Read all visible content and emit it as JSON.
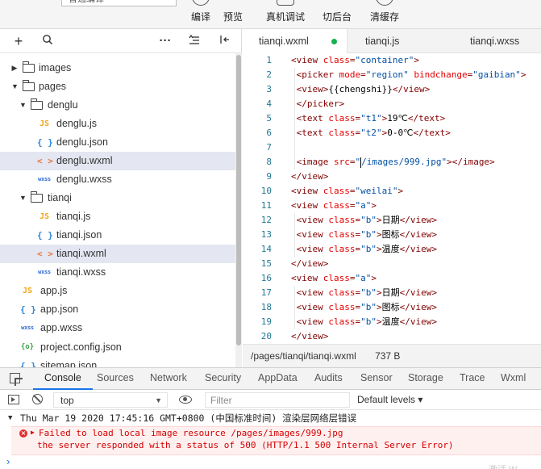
{
  "toolbar": {
    "compile_mode": "普通编译",
    "buttons": [
      {
        "label": "编译",
        "icon": "refresh-icon"
      },
      {
        "label": "预览",
        "icon": "eye-icon"
      },
      {
        "label": "真机调试",
        "icon": "debug-icon"
      },
      {
        "label": "切后台",
        "icon": "background-icon"
      },
      {
        "label": "清缓存",
        "icon": "clear-cache-icon"
      }
    ]
  },
  "explorer": {
    "tools": {
      "add": "+",
      "search": "search-icon",
      "more": "···",
      "sort": "sort-icon",
      "collapse": "collapse-icon"
    },
    "tree": [
      {
        "label": "images",
        "type": "folder",
        "expanded": false
      },
      {
        "label": "pages",
        "type": "folder",
        "expanded": true
      },
      {
        "label": "denglu",
        "type": "folder",
        "expanded": true
      },
      {
        "label": "denglu.js",
        "type": "js",
        "badge": "JS"
      },
      {
        "label": "denglu.json",
        "type": "json",
        "badge": "{ }"
      },
      {
        "label": "denglu.wxml",
        "type": "wxml",
        "badge": "< >"
      },
      {
        "label": "denglu.wxss",
        "type": "wxss",
        "badge": "wxss"
      },
      {
        "label": "tianqi",
        "type": "folder",
        "expanded": true
      },
      {
        "label": "tianqi.js",
        "type": "js",
        "badge": "JS"
      },
      {
        "label": "tianqi.json",
        "type": "json",
        "badge": "{ }"
      },
      {
        "label": "tianqi.wxml",
        "type": "wxml",
        "badge": "< >"
      },
      {
        "label": "tianqi.wxss",
        "type": "wxss",
        "badge": "wxss"
      },
      {
        "label": "app.js",
        "type": "js",
        "badge": "JS"
      },
      {
        "label": "app.json",
        "type": "json",
        "badge": "{ }"
      },
      {
        "label": "app.wxss",
        "type": "wxss",
        "badge": "wxss"
      },
      {
        "label": "project.config.json",
        "type": "cfg",
        "badge": "{o}"
      },
      {
        "label": "sitemap.json",
        "type": "json",
        "badge": "{ }"
      }
    ]
  },
  "editor": {
    "tabs": [
      {
        "label": "tianqi.wxml",
        "active": true,
        "modified": true
      },
      {
        "label": "tianqi.js",
        "active": false
      },
      {
        "label": "tianqi.wxss",
        "active": false
      }
    ],
    "lines": [
      {
        "n": "1",
        "segs": [
          [
            "tag",
            "<view "
          ],
          [
            "attr",
            "class"
          ],
          [
            "tag",
            "="
          ],
          [
            "val",
            "\"container\""
          ],
          [
            "tag",
            ">"
          ]
        ]
      },
      {
        "n": "2",
        "segs": [
          [
            "tag",
            " <picker "
          ],
          [
            "attr",
            "mode"
          ],
          [
            "tag",
            "="
          ],
          [
            "val",
            "\"region\""
          ],
          [
            "tag",
            " "
          ],
          [
            "attr",
            "bindchange"
          ],
          [
            "tag",
            "="
          ],
          [
            "val",
            "\"gaibian\""
          ],
          [
            "tag",
            ">"
          ]
        ]
      },
      {
        "n": "3",
        "segs": [
          [
            "tag",
            " <view>"
          ],
          [
            "txt",
            "{{chengshi}}"
          ],
          [
            "tag",
            "</view>"
          ]
        ]
      },
      {
        "n": "4",
        "segs": [
          [
            "tag",
            " </picker>"
          ]
        ]
      },
      {
        "n": "5",
        "segs": [
          [
            "tag",
            " <text "
          ],
          [
            "attr",
            "class"
          ],
          [
            "tag",
            "="
          ],
          [
            "val",
            "\"t1\""
          ],
          [
            "tag",
            ">"
          ],
          [
            "txt",
            "19℃"
          ],
          [
            "tag",
            "</text>"
          ]
        ]
      },
      {
        "n": "6",
        "segs": [
          [
            "tag",
            " <text "
          ],
          [
            "attr",
            "class"
          ],
          [
            "tag",
            "="
          ],
          [
            "val",
            "\"t2\""
          ],
          [
            "tag",
            ">"
          ],
          [
            "txt",
            "0-0℃"
          ],
          [
            "tag",
            "</text>"
          ]
        ]
      },
      {
        "n": "7",
        "segs": []
      },
      {
        "n": "8",
        "segs": [
          [
            "tag",
            " <image "
          ],
          [
            "attr",
            "src"
          ],
          [
            "tag",
            "="
          ],
          [
            "val",
            "\""
          ],
          [
            "cursor",
            ""
          ],
          [
            "val",
            "/images/999.jpg\""
          ],
          [
            "tag",
            "></image>"
          ]
        ]
      },
      {
        "n": "9",
        "segs": [
          [
            "tag",
            "</view>"
          ]
        ]
      },
      {
        "n": "10",
        "segs": [
          [
            "tag",
            "<view "
          ],
          [
            "attr",
            "class"
          ],
          [
            "tag",
            "="
          ],
          [
            "val",
            "\"weilai\""
          ],
          [
            "tag",
            ">"
          ]
        ]
      },
      {
        "n": "11",
        "segs": [
          [
            "tag",
            "<view "
          ],
          [
            "attr",
            "class"
          ],
          [
            "tag",
            "="
          ],
          [
            "val",
            "\"a\""
          ],
          [
            "tag",
            ">"
          ]
        ]
      },
      {
        "n": "12",
        "segs": [
          [
            "tag",
            " <view "
          ],
          [
            "attr",
            "class"
          ],
          [
            "tag",
            "="
          ],
          [
            "val",
            "\"b\""
          ],
          [
            "tag",
            ">"
          ],
          [
            "txt",
            "日期"
          ],
          [
            "tag",
            "</view>"
          ]
        ]
      },
      {
        "n": "13",
        "segs": [
          [
            "tag",
            " <view "
          ],
          [
            "attr",
            "class"
          ],
          [
            "tag",
            "="
          ],
          [
            "val",
            "\"b\""
          ],
          [
            "tag",
            ">"
          ],
          [
            "txt",
            "图标"
          ],
          [
            "tag",
            "</view>"
          ]
        ]
      },
      {
        "n": "14",
        "segs": [
          [
            "tag",
            " <view "
          ],
          [
            "attr",
            "class"
          ],
          [
            "tag",
            "="
          ],
          [
            "val",
            "\"b\""
          ],
          [
            "tag",
            ">"
          ],
          [
            "txt",
            "温度"
          ],
          [
            "tag",
            "</view>"
          ]
        ]
      },
      {
        "n": "15",
        "segs": [
          [
            "tag",
            "</view>"
          ]
        ]
      },
      {
        "n": "16",
        "segs": [
          [
            "tag",
            "<view "
          ],
          [
            "attr",
            "class"
          ],
          [
            "tag",
            "="
          ],
          [
            "val",
            "\"a\""
          ],
          [
            "tag",
            ">"
          ]
        ]
      },
      {
        "n": "17",
        "segs": [
          [
            "tag",
            " <view "
          ],
          [
            "attr",
            "class"
          ],
          [
            "tag",
            "="
          ],
          [
            "val",
            "\"b\""
          ],
          [
            "tag",
            ">"
          ],
          [
            "txt",
            "日期"
          ],
          [
            "tag",
            "</view>"
          ]
        ]
      },
      {
        "n": "18",
        "segs": [
          [
            "tag",
            " <view "
          ],
          [
            "attr",
            "class"
          ],
          [
            "tag",
            "="
          ],
          [
            "val",
            "\"b\""
          ],
          [
            "tag",
            ">"
          ],
          [
            "txt",
            "图标"
          ],
          [
            "tag",
            "</view>"
          ]
        ]
      },
      {
        "n": "19",
        "segs": [
          [
            "tag",
            " <view "
          ],
          [
            "attr",
            "class"
          ],
          [
            "tag",
            "="
          ],
          [
            "val",
            "\"b\""
          ],
          [
            "tag",
            ">"
          ],
          [
            "txt",
            "温度"
          ],
          [
            "tag",
            "</view>"
          ]
        ]
      },
      {
        "n": "20",
        "segs": [
          [
            "tag",
            "</view>"
          ]
        ]
      }
    ],
    "status": {
      "path": "/pages/tianqi/tianqi.wxml",
      "size": "737 B"
    }
  },
  "devtools": {
    "tabs": [
      "Console",
      "Sources",
      "Network",
      "Security",
      "AppData",
      "Audits",
      "Sensor",
      "Storage",
      "Trace",
      "Wxml"
    ],
    "active_tab": "Console",
    "context": "top",
    "filter_placeholder": "Filter",
    "levels": "Default levels ▾",
    "group_header": "Thu Mar 19 2020 17:45:16 GMT+0800 (中国标准时间) 渲染层网络层错误",
    "error_line1": "Failed to load local image resource /pages/images/999.jpg",
    "error_line2": "the server responded with a status of 500 (HTTP/1.1 500 Internal Server Error)",
    "prompt": "›"
  },
  "watermark": "激活 W"
}
